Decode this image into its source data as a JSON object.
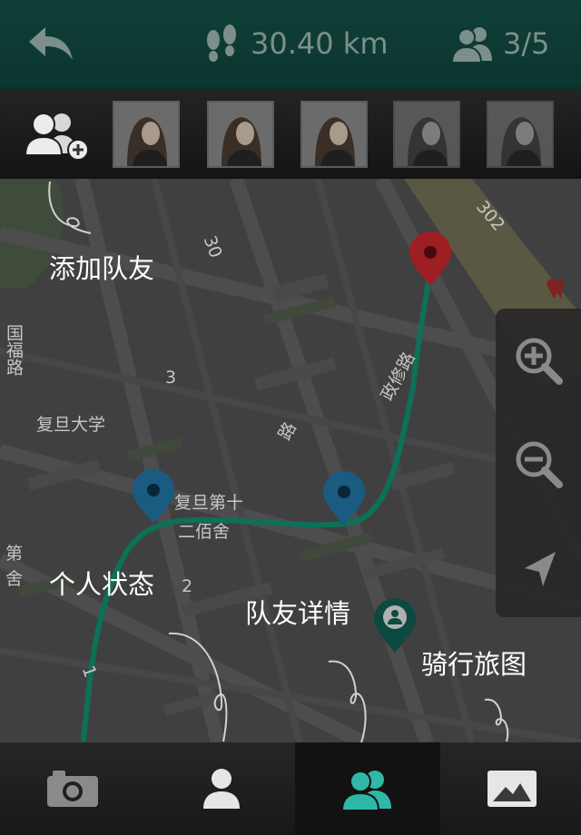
{
  "header": {
    "distance": "30.40 km",
    "team_count": "3/5",
    "icons": [
      "back-arrow-icon",
      "footprints-icon",
      "team-icon"
    ]
  },
  "strip": {
    "icons": [
      "add-teammate-icon"
    ],
    "avatar_count": 5
  },
  "map": {
    "labels": {
      "fudan": "复旦大学",
      "school_top": "复旦第十",
      "school_bottom": "二佰舍",
      "zhengxiu": "政修路",
      "lu": "路",
      "guofu": "国福路",
      "di": "第",
      "she": "舍",
      "n30": "30",
      "n3": "3",
      "n2": "2",
      "n1": "1",
      "n302": "302"
    }
  },
  "annotations": {
    "add_teammate": "添加队友",
    "personal_status": "个人状态",
    "teammate_details": "队友详情",
    "riding_map": "骑行旅图"
  },
  "tabs": [
    {
      "icon": "camera-icon"
    },
    {
      "icon": "person-icon"
    },
    {
      "icon": "team-icon",
      "active": true
    },
    {
      "icon": "landscape-image-icon"
    }
  ],
  "colors": {
    "header_bg": "#0f4038",
    "accent_teal": "#2fb8a8",
    "route": "#0f8a6a",
    "pin_red": "#c0272d",
    "pin_blue": "#1f6f9e",
    "pin_teal": "#0f5a4f"
  }
}
